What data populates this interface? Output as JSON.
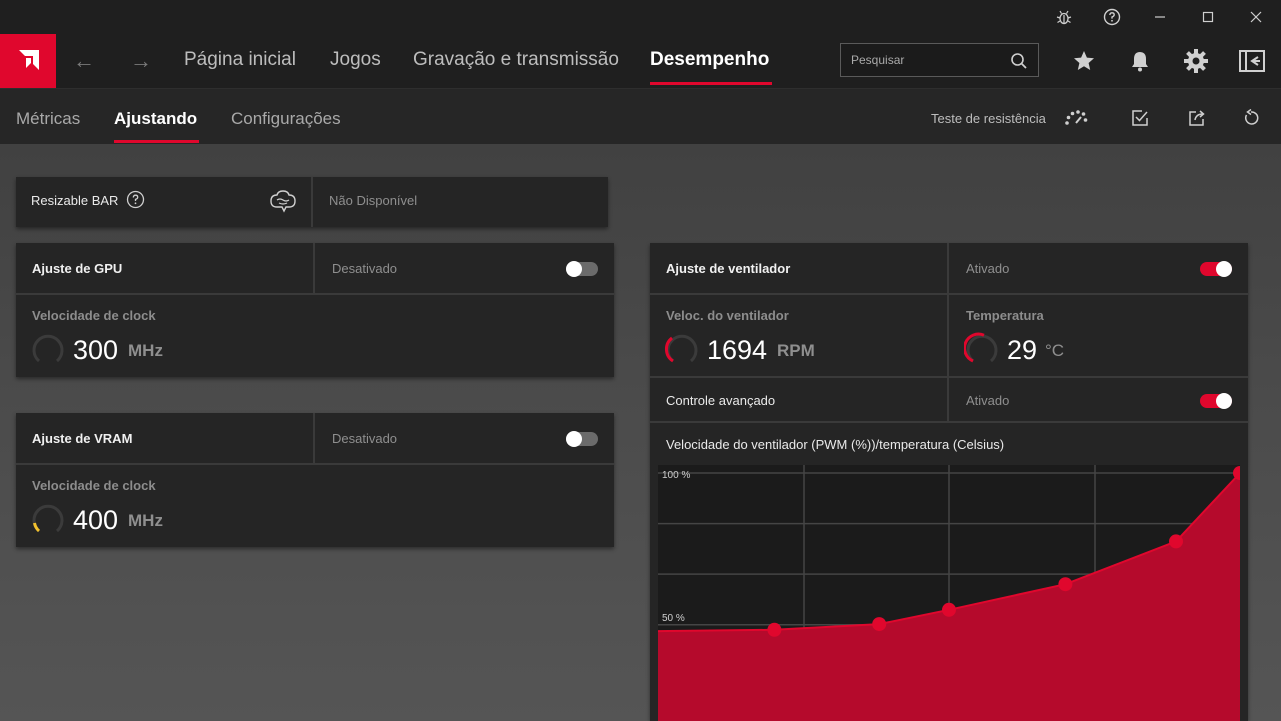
{
  "window": {
    "controls": [
      "bug-icon",
      "help-icon",
      "minimize-icon",
      "maximize-icon",
      "close-icon"
    ]
  },
  "nav": {
    "tabs": [
      "Página inicial",
      "Jogos",
      "Gravação e transmissão",
      "Desempenho"
    ],
    "active_tab": "Desempenho",
    "search_placeholder": "Pesquisar",
    "accent": "#e0072d"
  },
  "subnav": {
    "tabs": [
      "Métricas",
      "Ajustando",
      "Configurações"
    ],
    "active_tab": "Ajustando",
    "stress_test_label": "Teste de resistência"
  },
  "resizable_bar": {
    "label": "Resizable BAR",
    "status": "Não Disponível"
  },
  "gpu_tuning": {
    "title": "Ajuste de GPU",
    "status": "Desativado",
    "enabled": false,
    "metric_label": "Velocidade de clock",
    "value": "300",
    "unit": "MHz"
  },
  "vram_tuning": {
    "title": "Ajuste de VRAM",
    "status": "Desativado",
    "enabled": false,
    "metric_label": "Velocidade de clock",
    "value": "400",
    "unit": "MHz"
  },
  "fan_tuning": {
    "title": "Ajuste de ventilador",
    "status": "Ativado",
    "enabled": true,
    "speed_label": "Veloc. do ventilador",
    "speed_value": "1694",
    "speed_unit": "RPM",
    "temp_label": "Temperatura",
    "temp_value": "29",
    "temp_unit": "°C",
    "advanced_label": "Controle avançado",
    "advanced_status": "Ativado",
    "advanced_enabled": true,
    "curve_title": "Velocidade do ventilador (PWM (%))/temperatura (Celsius)"
  },
  "chart_data": {
    "type": "area",
    "title": "Velocidade do ventilador (PWM (%))/temperatura (Celsius)",
    "ylim": [
      0,
      100
    ],
    "ytick_labels": [
      "100 %",
      "50 %"
    ],
    "grid": true,
    "x": [
      20,
      38,
      50,
      70,
      89,
      100
    ],
    "values": [
      0.45,
      0.47,
      0.52,
      0.61,
      0.76,
      1.0
    ],
    "series": [
      {
        "values": [
          45,
          47,
          52,
          61,
          76,
          100
        ]
      }
    ],
    "color": "#e0072d"
  }
}
